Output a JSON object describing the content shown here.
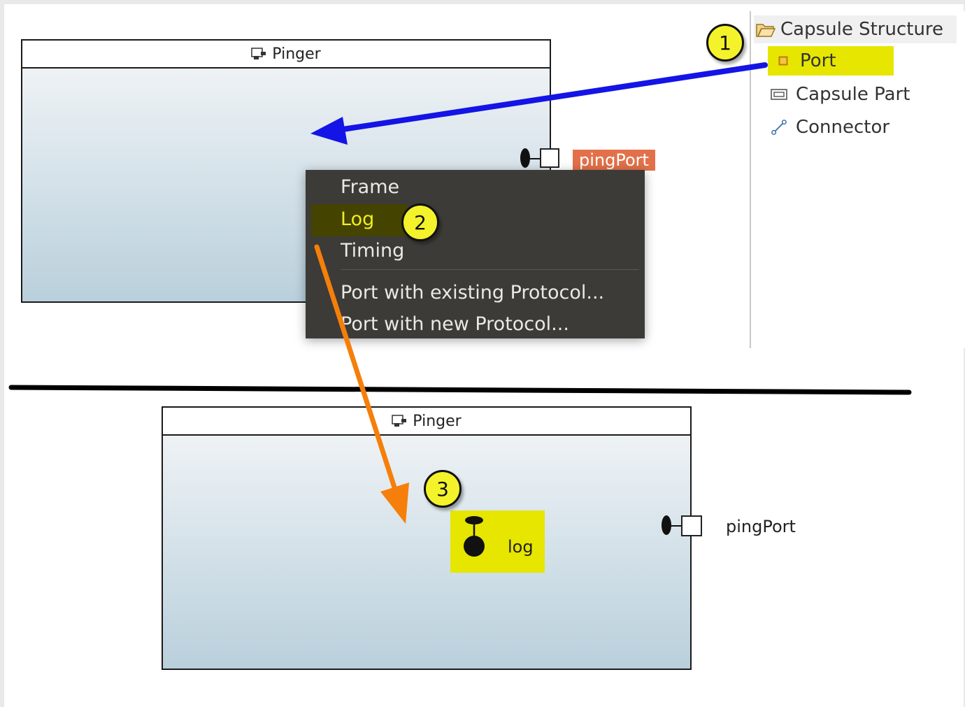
{
  "top_diagram": {
    "capsule_title": "Pinger",
    "port_label": "pingPort"
  },
  "palette": {
    "title": "Capsule Structure",
    "items": [
      {
        "label": "Port",
        "icon": "port-icon"
      },
      {
        "label": "Capsule Part",
        "icon": "capsule-part-icon"
      },
      {
        "label": "Connector",
        "icon": "connector-icon"
      }
    ]
  },
  "context_menu": {
    "items": [
      "Frame",
      "Log",
      "Timing"
    ],
    "items2": [
      "Port with existing Protocol...",
      "Port with new Protocol..."
    ],
    "highlighted": "Log"
  },
  "bottom_diagram": {
    "capsule_title": "Pinger",
    "log_port_label": "log",
    "port_label": "pingPort"
  },
  "callouts": [
    "1",
    "2",
    "3"
  ],
  "colors": {
    "highlight": "#e6e600",
    "blue_arrow": "#1414e6",
    "orange_arrow": "#f57f0a",
    "port_tag": "#e2714a",
    "menu_bg": "#3c3b37"
  }
}
